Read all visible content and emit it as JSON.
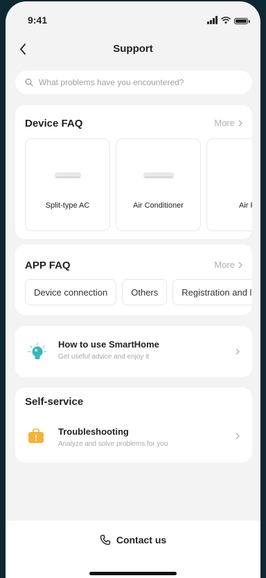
{
  "status_bar": {
    "time": "9:41"
  },
  "header": {
    "title": "Support"
  },
  "search": {
    "placeholder": "What problems have you encountered?"
  },
  "device_faq": {
    "title": "Device FAQ",
    "more_label": "More",
    "devices": [
      {
        "label": "Split-type AC",
        "icon": "split-ac-icon"
      },
      {
        "label": "Air Conditioner",
        "icon": "air-conditioner-icon"
      },
      {
        "label": "Air Fryer",
        "icon": "air-fryer-icon"
      }
    ]
  },
  "app_faq": {
    "title": "APP FAQ",
    "more_label": "More",
    "chips": [
      "Device connection",
      "Others",
      "Registration and login"
    ]
  },
  "guide": {
    "title": "How to use SmartHome",
    "subtitle": "Get useful advice and enjoy it"
  },
  "self_service": {
    "title": "Self-service",
    "item_title": "Troubleshooting",
    "item_subtitle": "Analyze and solve problems for you"
  },
  "footer": {
    "contact_label": "Contact us"
  },
  "colors": {
    "background": "#f3f3f3",
    "accent_teal": "#3bb7b8",
    "accent_orange": "#f5b335",
    "muted_text": "#a8a8a8"
  }
}
